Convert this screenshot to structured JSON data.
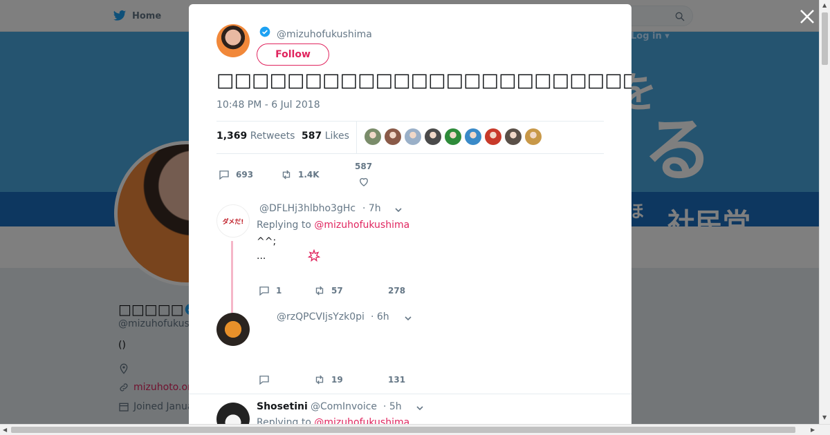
{
  "nav": {
    "home_label": "Home",
    "login_label": "Log in ▾"
  },
  "profile": {
    "name": "□□□□□",
    "handle": "@mizuhofukus",
    "bio": "()",
    "url": "mizuhoto.or",
    "joined": "Joined Janua"
  },
  "banner": {
    "text_large": "る",
    "text_top": "を",
    "text_small": "ほ",
    "text_party": "社民党"
  },
  "tweet": {
    "handle": "@mizuhofukushima",
    "follow_label": "Follow",
    "text": "□□□□□□□□□□□□□□□□□□□□□□□□□□□□□□□□□□□□□□",
    "time": "10:48 PM - 6 Jul 2018",
    "retweets_count": "1,369",
    "retweets_label": "Retweets",
    "likes_count": "587",
    "likes_label": "Likes",
    "reply_count": "693",
    "retweet_count": "1.4K",
    "like_count": "587",
    "liker_colors": [
      "#7a8c6a",
      "#8a5a48",
      "#9ab0c8",
      "#4a4a4a",
      "#2e8b3a",
      "#3a8ac8",
      "#c83a2a",
      "#5a5048",
      "#c89848"
    ]
  },
  "replies": [
    {
      "handle": "@DFLHj3hlbho3gHc",
      "time": "· 7h",
      "replying_prefix": "Replying to",
      "replying_to": "@mizuhofukushima",
      "line1": "^^;",
      "line2": "...",
      "reply_count": "1",
      "retweet_count": "57",
      "like_count": "278"
    },
    {
      "handle": "@rzQPCVIjsYzk0pi",
      "time": "· 6h",
      "reply_count": "",
      "retweet_count": "19",
      "like_count": "131"
    },
    {
      "name": "Shosetini",
      "handle": "@ComInvoice",
      "time": "· 5h",
      "replying_prefix": "Replying to",
      "replying_to": "@mizuhofukushima"
    }
  ],
  "colors": {
    "accent": "#e0245e",
    "twitter_blue": "#1da1f2",
    "muted": "#657786"
  }
}
